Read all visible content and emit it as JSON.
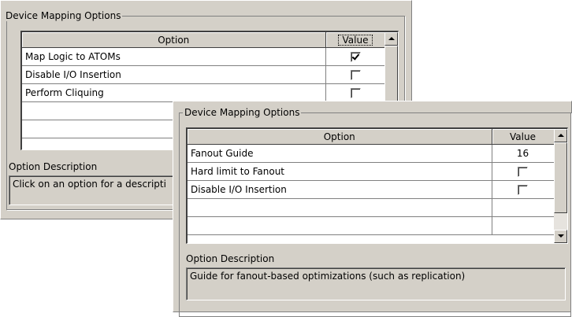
{
  "back_panel": {
    "group_title": "Device Mapping Options",
    "columns": {
      "option": "Option",
      "value": "Value"
    },
    "rows": [
      {
        "option": "Map Logic to ATOMs",
        "checked": true
      },
      {
        "option": "Disable I/O Insertion",
        "checked": false
      },
      {
        "option": "Perform Cliquing",
        "checked": false
      },
      {
        "option": "",
        "checked": null
      },
      {
        "option": "",
        "checked": null
      }
    ],
    "description_label": "Option Description",
    "description_text": "Click on an option for a descripti"
  },
  "front_panel": {
    "group_title": "Device Mapping Options",
    "columns": {
      "option": "Option",
      "value": "Value"
    },
    "rows": [
      {
        "option": "Fanout Guide",
        "value": "16"
      },
      {
        "option": "Hard limit to Fanout",
        "checked": false
      },
      {
        "option": "Disable I/O Insertion",
        "checked": false
      },
      {
        "option": "",
        "value": ""
      },
      {
        "option": "",
        "value": ""
      }
    ],
    "description_label": "Option Description",
    "description_text": "Guide for fanout-based optimizations (such as replication)"
  },
  "icons": {
    "scroll_up": "triangle-up-icon",
    "scroll_down": "triangle-down-icon",
    "checkbox": "checkbox-icon"
  },
  "colors": {
    "face": "#d4d0c8",
    "grid_bg": "#ffffff",
    "shadow": "#808080"
  }
}
